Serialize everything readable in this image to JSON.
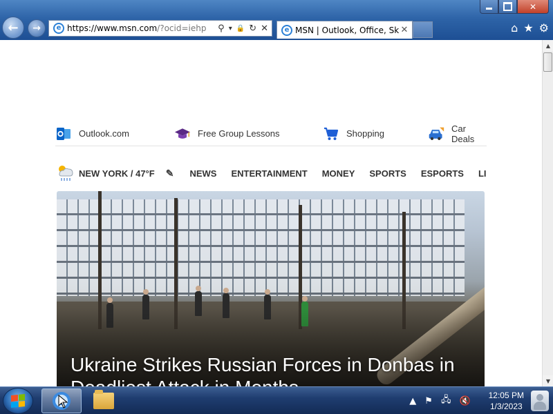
{
  "browser": {
    "address": {
      "protocol": "https://",
      "host": "www.msn.com",
      "path": "/?ocid=iehp"
    },
    "tab": {
      "title": "MSN | Outlook, Office, Sky...",
      "close_glyph": "✕"
    },
    "nav": {
      "back_glyph": "←",
      "forward_glyph": "→"
    },
    "addr_buttons": {
      "search": "⚲",
      "dropdown": "▾",
      "lock": "🔒",
      "refresh": "↻",
      "stop": "✕"
    },
    "command_icons": {
      "home": "⌂",
      "favorites": "★",
      "tools": "⚙"
    }
  },
  "page": {
    "quick_links": [
      {
        "label": "Outlook.com",
        "icon": "outlook-icon"
      },
      {
        "label": "Free Group Lessons",
        "icon": "graduation-cap-icon"
      },
      {
        "label": "Shopping",
        "icon": "shopping-cart-icon"
      },
      {
        "label": "Car Deals",
        "icon": "car-icon"
      }
    ],
    "weather": {
      "label": "NEW YORK / 47°F",
      "icon": "weather-rain-icon",
      "edit_glyph": "✎"
    },
    "nav_links": [
      "NEWS",
      "ENTERTAINMENT",
      "MONEY",
      "SPORTS",
      "ESPORTS",
      "LIFESTYLE"
    ],
    "hero": {
      "headline": "Ukraine Strikes Russian Forces in Donbas in Deadliest Attack in Months"
    }
  },
  "taskbar": {
    "clock_time": "12:05 PM",
    "clock_date": "1/3/2023",
    "tray_icons": [
      "show-hidden-icons-icon",
      "action-center-flag-icon",
      "network-icon",
      "volume-muted-icon"
    ]
  },
  "colors": {
    "titlebar": "#2e64a8",
    "taskbar": "#1f3d70",
    "outlook_blue": "#0a64c8",
    "cap_purple": "#5b2a86",
    "cart_blue": "#1f5fd6",
    "car_blue": "#2a6fd0"
  }
}
